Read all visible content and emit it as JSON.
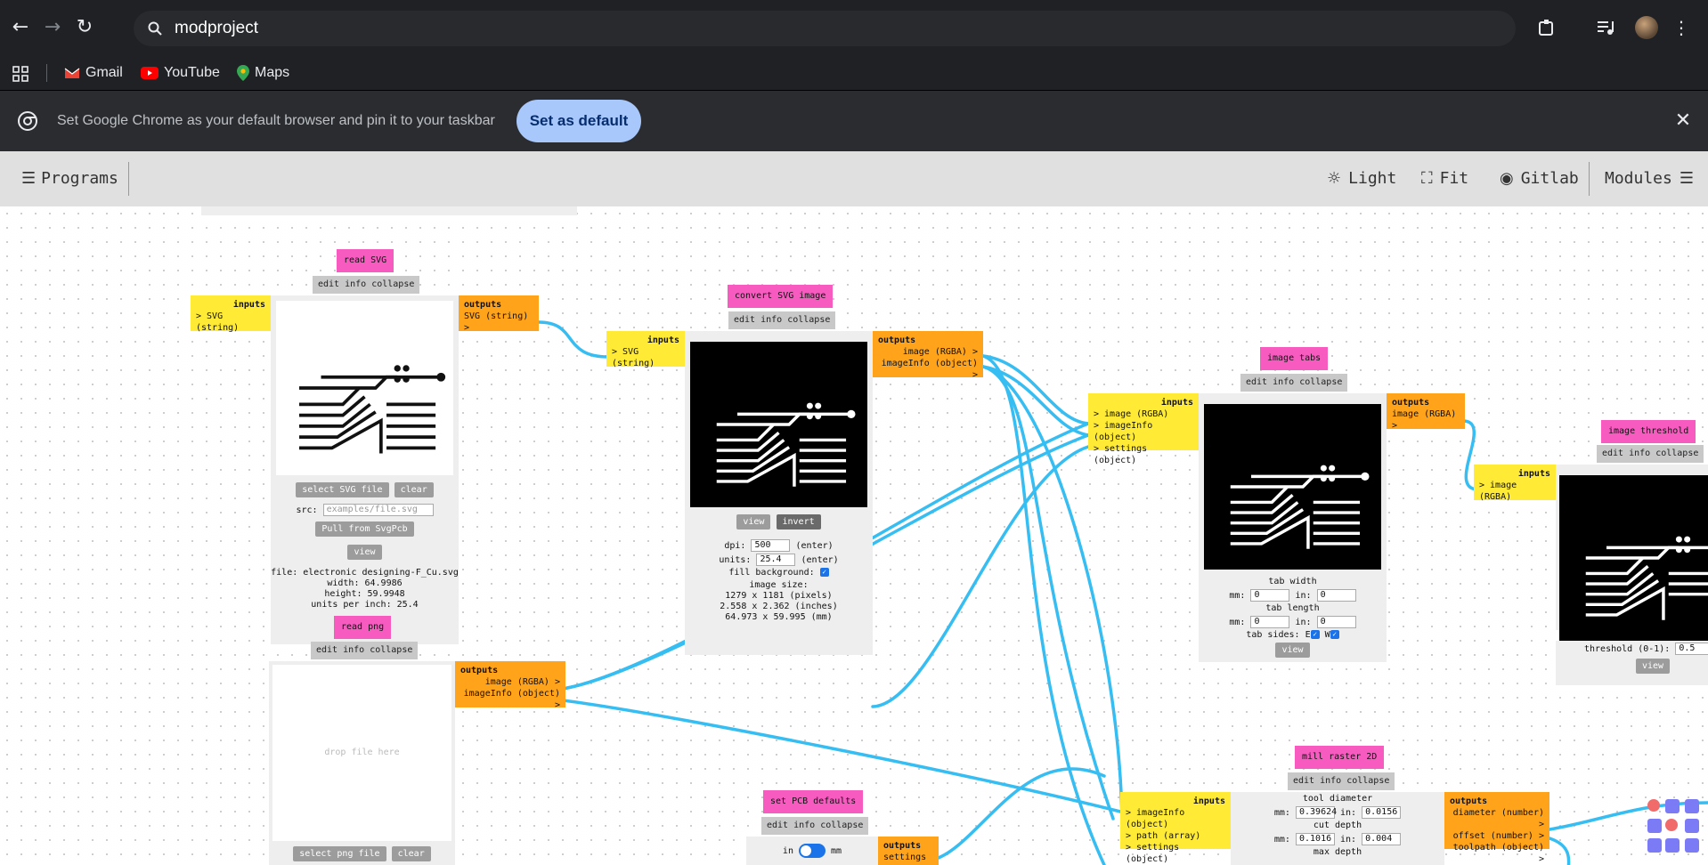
{
  "browser": {
    "url": "modproject",
    "bookmarks": [
      "Gmail",
      "YouTube",
      "Maps"
    ],
    "infobar_message": "Set Google Chrome as your default browser and pin it to your taskbar",
    "set_default_label": "Set as default"
  },
  "header": {
    "programs": "Programs",
    "light": "Light",
    "fit": "Fit",
    "gitlab": "Gitlab",
    "modules": "Modules"
  },
  "common": {
    "edit_info_collapse": "edit info collapse",
    "inputs": "inputs",
    "outputs": "outputs"
  },
  "read_svg": {
    "title": "read SVG",
    "input": "> SVG (string)",
    "output": "SVG (string) >",
    "select_btn": "select SVG file",
    "clear_btn": "clear",
    "src_label": "src:",
    "src_placeholder": "examples/file.svg",
    "pull_btn": "Pull from SvgPcb",
    "view_btn": "view",
    "file": "file: electronic designing-F_Cu.svg",
    "width": "width: 64.9986",
    "height": "height: 59.9948",
    "units": "units per inch: 25.4"
  },
  "read_png": {
    "title": "read png",
    "drop": "drop file here",
    "select_btn": "select png file",
    "clear_btn": "clear",
    "out1": "image (RGBA) >",
    "out2": "imageInfo (object) >"
  },
  "convert_svg": {
    "title": "convert SVG image",
    "input": "> SVG (string)",
    "out1": "image (RGBA) >",
    "out2": "imageInfo (object) >",
    "view_btn": "view",
    "invert_btn": "invert",
    "dpi_label": "dpi:",
    "dpi_value": "500",
    "enter": "(enter)",
    "units_label": "units:",
    "units_value": "25.4",
    "fill_bg": "fill background:",
    "image_size": "image size:",
    "px": "1279 x 1181 (pixels)",
    "inches": "2.558 x 2.362 (inches)",
    "mm": "64.973 x 59.995 (mm)"
  },
  "image_tabs": {
    "title": "image tabs",
    "in1": "> image (RGBA)",
    "in2": "> imageInfo (object)",
    "in3": "> settings (object)",
    "out1": "image (RGBA) >",
    "tab_width": "tab width",
    "tab_length": "tab length",
    "mm_label": "mm:",
    "in_label": "in:",
    "zero": "0",
    "tab_sides": "tab sides:",
    "side_e": "E",
    "side_w": "W",
    "view_btn": "view"
  },
  "image_threshold": {
    "title": "image threshold",
    "in1": "> image (RGBA)",
    "threshold_label": "threshold (0-1):",
    "threshold_value": "0.5",
    "view_btn": "view"
  },
  "mill_raster": {
    "title": "mill raster 2D",
    "in1": "> imageInfo (object)",
    "in2": "> path (array)",
    "in3": "> settings (object)",
    "out1": "diameter (number) >",
    "out2": "offset (number) >",
    "out3": "toolpath (object) >",
    "tool_diameter": "tool diameter",
    "td_mm": "0.39624",
    "td_in": "0.0156",
    "cut_depth": "cut depth",
    "cd_mm": "0.1016",
    "cd_in": "0.004",
    "max_depth": "max depth",
    "mm_label": "mm:",
    "in_label": "in:"
  },
  "pcb_defaults": {
    "title": "set PCB defaults",
    "toggle_in": "in",
    "toggle_mm": "mm",
    "out1": "settings >"
  },
  "colors": {
    "title_pink": "#f75bc0",
    "inputs_yellow": "#ffea35",
    "outputs_orange": "#ffa31a",
    "wire_blue": "#36bdf2",
    "chrome_dark": "#202124",
    "accent_blue": "#a8c7fa"
  }
}
